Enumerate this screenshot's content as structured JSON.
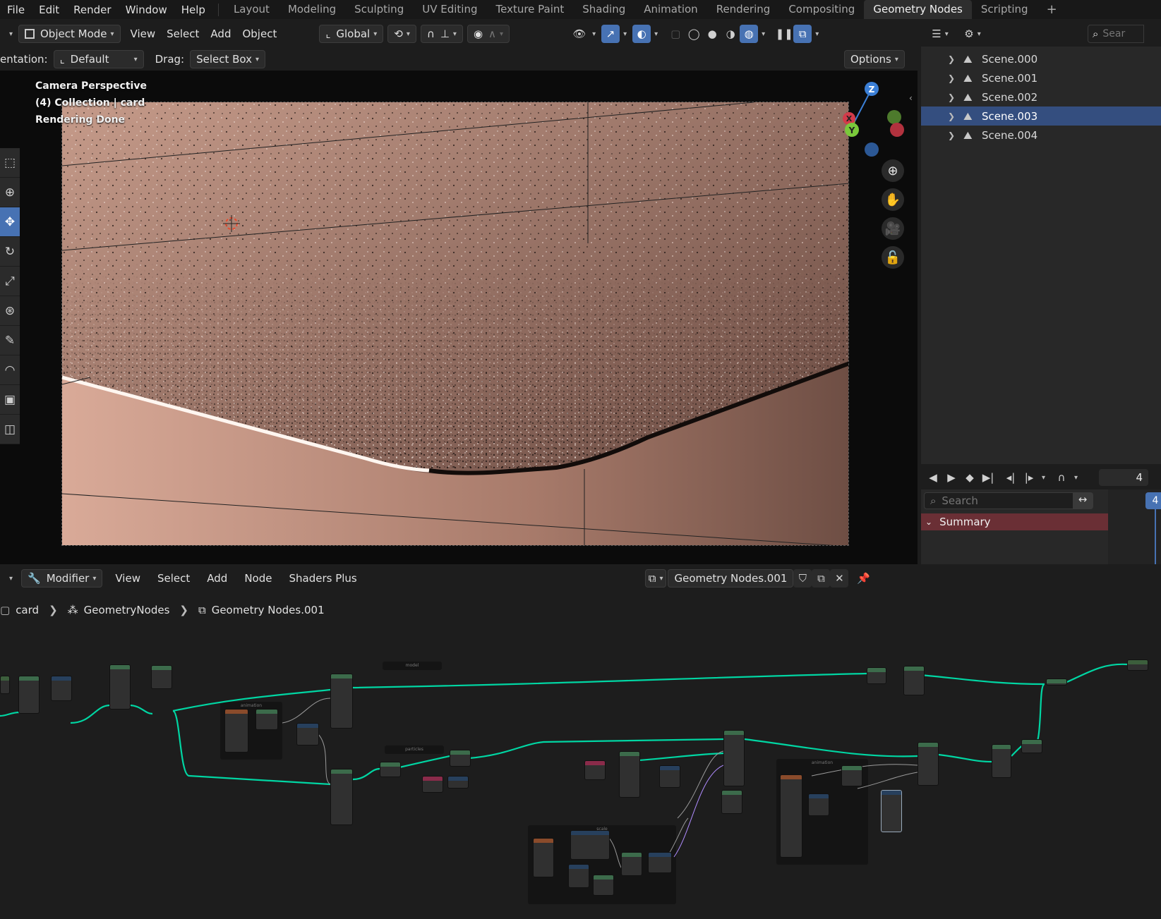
{
  "top_menu": [
    "File",
    "Edit",
    "Render",
    "Window",
    "Help"
  ],
  "workspace_tabs": [
    {
      "label": "Layout",
      "active": false
    },
    {
      "label": "Modeling",
      "active": false
    },
    {
      "label": "Sculpting",
      "active": false
    },
    {
      "label": "UV Editing",
      "active": false
    },
    {
      "label": "Texture Paint",
      "active": false
    },
    {
      "label": "Shading",
      "active": false
    },
    {
      "label": "Animation",
      "active": false
    },
    {
      "label": "Rendering",
      "active": false
    },
    {
      "label": "Compositing",
      "active": false
    },
    {
      "label": "Geometry Nodes",
      "active": true
    },
    {
      "label": "Scripting",
      "active": false
    }
  ],
  "add_tab_icon": "plus-icon",
  "viewport_header": {
    "mode": "Object Mode",
    "menus": [
      "View",
      "Select",
      "Add",
      "Object"
    ],
    "orientation": "Global"
  },
  "viewport_header2": {
    "orientation_label": "entation:",
    "orientation_value": "Default",
    "drag_label": "Drag:",
    "drag_value": "Select Box",
    "options": "Options"
  },
  "viewport_info": {
    "line1": "Camera Perspective",
    "line2": "(4) Collection | card",
    "line3": "Rendering Done"
  },
  "gizmo": {
    "z": "Z",
    "x": "X",
    "y": "Y"
  },
  "outliner": {
    "search_placeholder": "Sear",
    "scenes": [
      {
        "name": "Scene.000",
        "selected": false
      },
      {
        "name": "Scene.001",
        "selected": false
      },
      {
        "name": "Scene.002",
        "selected": false
      },
      {
        "name": "Scene.003",
        "selected": true
      },
      {
        "name": "Scene.004",
        "selected": false
      }
    ]
  },
  "timeline": {
    "current_frame": "4",
    "search_placeholder": "Search",
    "summary": "Summary",
    "frame_marker": "4"
  },
  "node_editor_header": {
    "editor_type": "Modifier",
    "menus": [
      "View",
      "Select",
      "Add",
      "Node",
      "Shaders Plus"
    ],
    "node_group": "Geometry Nodes.001"
  },
  "breadcrumb": {
    "object": "card",
    "modifier": "GeometryNodes",
    "group": "Geometry Nodes.001"
  },
  "frames": {
    "animation1": "animation",
    "particles": "particles",
    "model": "model",
    "scale": "scale",
    "animation2": "animation"
  },
  "colors": {
    "accent": "#4772b3",
    "selection": "#344e7f",
    "summary": "#6a2f35",
    "link_geometry": "#00d6a3",
    "render_tone": "#b4897a"
  }
}
